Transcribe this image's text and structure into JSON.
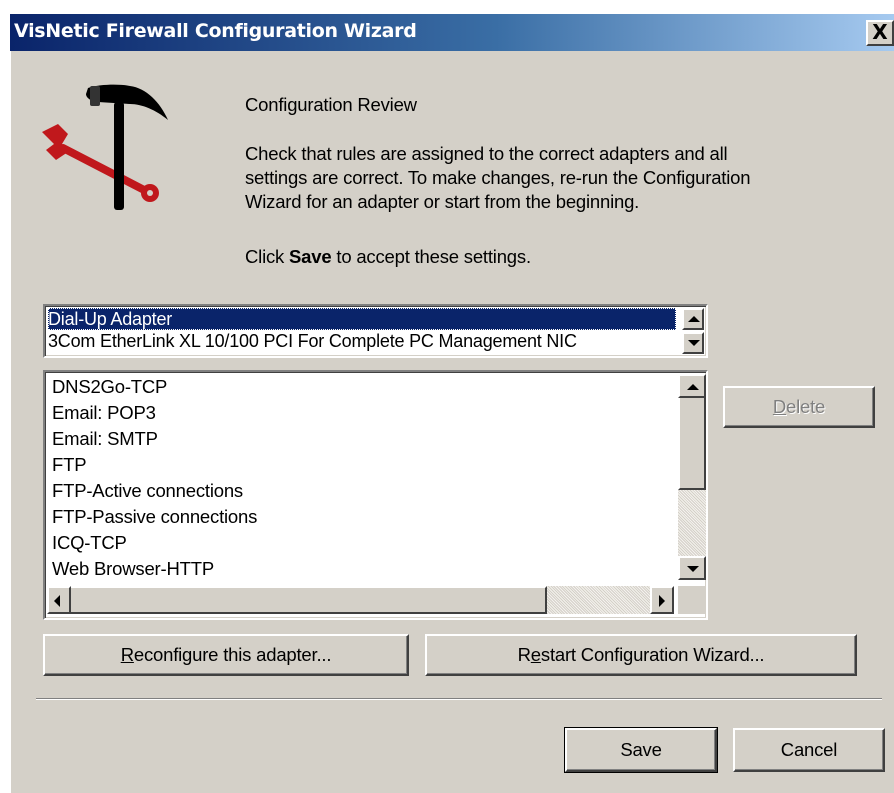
{
  "window": {
    "title": "VisNetic Firewall Configuration Wizard",
    "close_glyph": "X"
  },
  "icon": "hammer-and-wrench-icon",
  "heading": "Configuration Review",
  "description_lines": [
    "Check that rules are assigned to the correct adapters and all",
    "settings are correct. To make changes, re-run the Configuration",
    "Wizard for an adapter or start from the beginning."
  ],
  "instruction": {
    "prefix": "Click ",
    "bold": "Save",
    "suffix": " to accept these settings."
  },
  "adapters": {
    "items": [
      "Dial-Up Adapter",
      "3Com EtherLink XL 10/100 PCI For Complete PC Management NIC"
    ],
    "selected": "Dial-Up Adapter"
  },
  "rules": [
    "DNS2Go-TCP",
    "Email: POP3",
    "Email: SMTP",
    "FTP",
    "FTP-Active connections",
    "FTP-Passive connections",
    "ICQ-TCP",
    "Web Browser-HTTP"
  ],
  "buttons": {
    "delete": {
      "mnemonic": "D",
      "rest": "elete",
      "enabled": false
    },
    "reconfigure": {
      "mnemonic": "R",
      "rest": "econfigure this adapter..."
    },
    "restart": {
      "before": "R",
      "mnemonic": "e",
      "rest": "start Configuration Wizard..."
    },
    "save": "Save",
    "cancel": "Cancel"
  },
  "colors": {
    "title_gradient_start": "#0a246a",
    "title_gradient_end": "#a6caf0",
    "selection": "#0a246a",
    "face": "#d4d0c8",
    "icon_red": "#c0181c"
  }
}
